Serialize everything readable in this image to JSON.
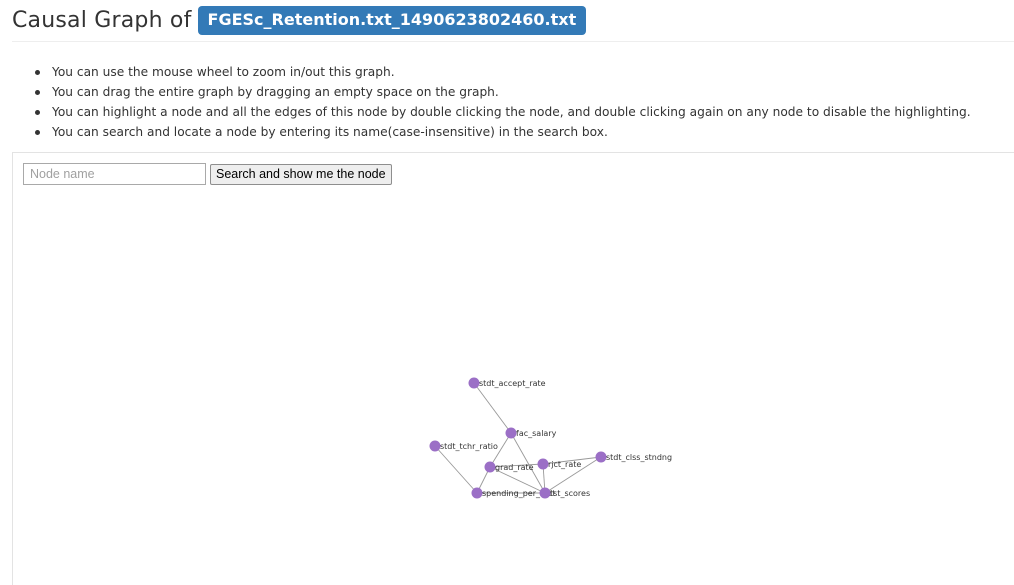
{
  "header": {
    "title_prefix": "Causal Graph of",
    "file_name": "FGESc_Retention.txt_1490623802460.txt"
  },
  "instructions": [
    "You can use the mouse wheel to zoom in/out this graph.",
    "You can drag the entire graph by dragging an empty space on the graph.",
    "You can highlight a node and all the edges of this node by double clicking the node, and double clicking again on any node to disable the highlighting.",
    "You can search and locate a node by entering its name(case-insensitive) in the search box."
  ],
  "search": {
    "placeholder": "Node name",
    "value": "",
    "button_label": "Search and show me the node"
  },
  "graph": {
    "node_color": "#9b6fc6",
    "edge_color": "#999999",
    "nodes": [
      "stdt_accept_rate",
      "fac_salary",
      "stdt_tchr_ratio",
      "grad_rate",
      "rjct_rate",
      "stdt_clss_stndng",
      "spending_per_stdt",
      "tst_scores"
    ],
    "edges": [
      [
        "stdt_accept_rate",
        "fac_salary"
      ],
      [
        "fac_salary",
        "grad_rate"
      ],
      [
        "fac_salary",
        "tst_scores"
      ],
      [
        "stdt_tchr_ratio",
        "spending_per_stdt"
      ],
      [
        "grad_rate",
        "spending_per_stdt"
      ],
      [
        "grad_rate",
        "rjct_rate"
      ],
      [
        "grad_rate",
        "tst_scores"
      ],
      [
        "rjct_rate",
        "stdt_clss_stndng"
      ],
      [
        "rjct_rate",
        "tst_scores"
      ],
      [
        "stdt_clss_stndng",
        "tst_scores"
      ],
      [
        "spending_per_stdt",
        "tst_scores"
      ]
    ]
  }
}
